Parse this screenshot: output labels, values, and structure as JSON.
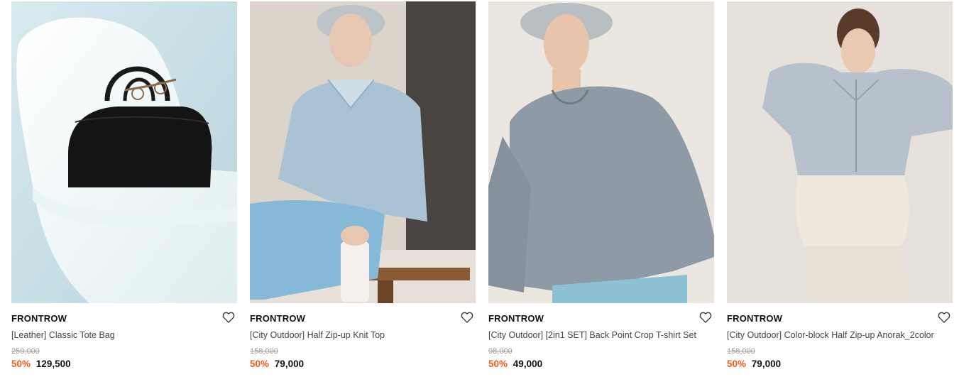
{
  "products": [
    {
      "brand": "FRONTROW",
      "title": "[Leather] Classic Tote Bag",
      "original_price": "259,000",
      "discount": "50%",
      "price": "129,500",
      "image_subject": "black leather tote bag on white chair"
    },
    {
      "brand": "FRONTROW",
      "title": "[City Outdoor] Half Zip-up Knit Top",
      "original_price": "158,000",
      "discount": "50%",
      "price": "79,000",
      "image_subject": "model in light blue half zip-up knit top"
    },
    {
      "brand": "FRONTROW",
      "title": "[City Outdoor] [2in1 SET] Back Point Crop T-shirt Set",
      "original_price": "98,000",
      "discount": "50%",
      "price": "49,000",
      "image_subject": "model in grey crop t-shirt"
    },
    {
      "brand": "FRONTROW",
      "title": "[City Outdoor] Color-block Half Zip-up Anorak_2color",
      "original_price": "158,000",
      "discount": "50%",
      "price": "79,000",
      "image_subject": "model in color-block anorak"
    }
  ],
  "colors": {
    "discount": "#f25c1d",
    "price": "#111111",
    "original_price": "#999999"
  },
  "icons": {
    "wishlist": "heart-outline-icon"
  }
}
